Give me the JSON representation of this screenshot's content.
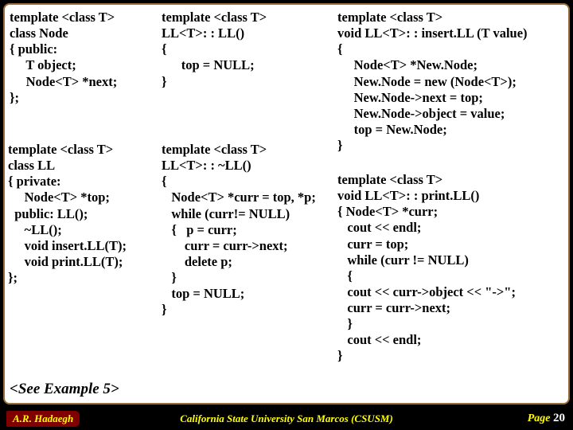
{
  "col1a": "template <class T>\nclass Node\n{ public:\n     T object;\n     Node<T> *next;\n};",
  "col1b": "template <class T>\nclass LL\n{ private:\n     Node<T> *top;\n  public: LL();\n     ~LL();\n     void insert.LL(T);\n     void print.LL(T);\n};",
  "col2a": "template <class T>\nLL<T>: : LL()\n{\n      top = NULL;\n}",
  "col2b": "template <class T>\nLL<T>: : ~LL()\n{\n   Node<T> *curr = top, *p;\n   while (curr!= NULL)\n   {   p = curr;\n       curr = curr->next;\n       delete p;\n   }\n   top = NULL;\n}",
  "col3a": "template <class T>\nvoid LL<T>: : insert.LL (T value)\n{\n     Node<T> *New.Node;\n     New.Node = new (Node<T>);\n     New.Node->next = top;\n     New.Node->object = value;\n     top = New.Node;\n}",
  "col3b": "template <class T>\nvoid LL<T>: : print.LL()\n{ Node<T> *curr;\n   cout << endl;\n   curr = top;\n   while (curr != NULL)\n   {\n   cout << curr->object << \"->\";\n   curr = curr->next;\n   }\n   cout << endl;\n}",
  "see": "<See Example 5>",
  "footer": {
    "author": "A.R. Hadaegh",
    "center": "California State University San Marcos (CSUSM)",
    "page_label": "Page ",
    "page_num": "20"
  }
}
